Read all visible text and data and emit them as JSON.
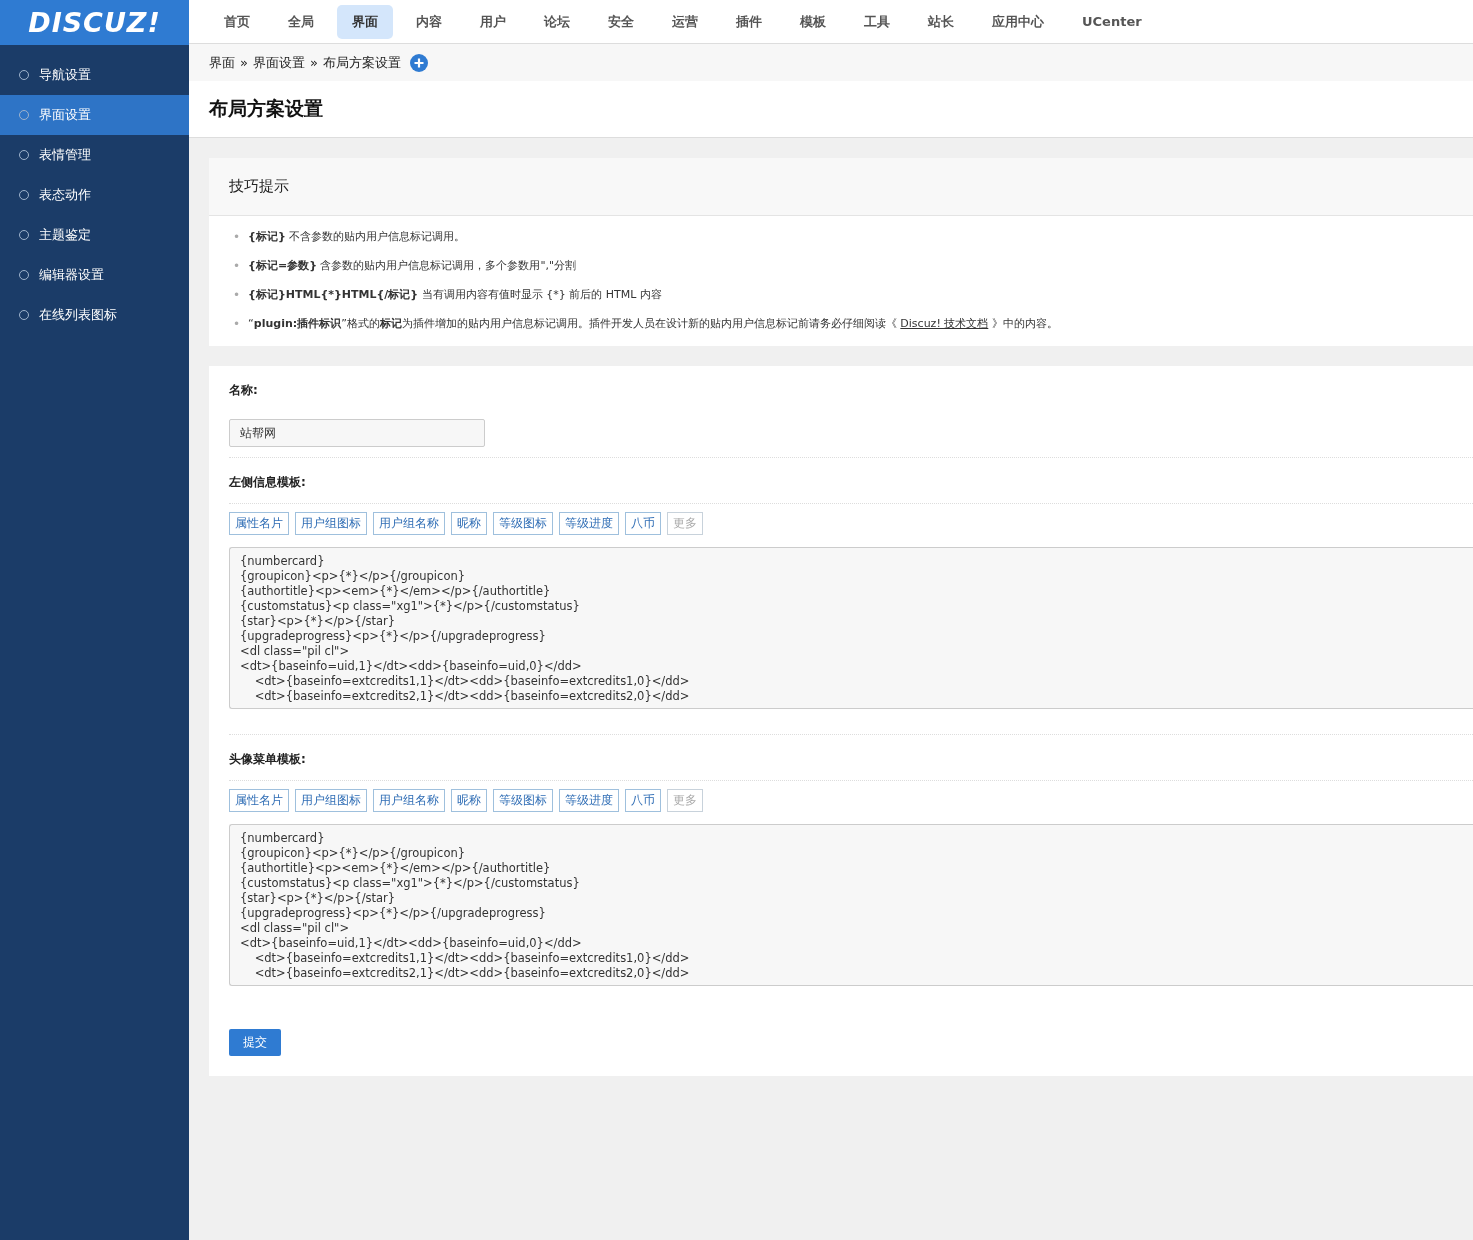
{
  "logo": "DISCUZ!",
  "top_nav": [
    {
      "label": "首页",
      "selected": false
    },
    {
      "label": "全局",
      "selected": false
    },
    {
      "label": "界面",
      "selected": true
    },
    {
      "label": "内容",
      "selected": false
    },
    {
      "label": "用户",
      "selected": false
    },
    {
      "label": "论坛",
      "selected": false
    },
    {
      "label": "安全",
      "selected": false
    },
    {
      "label": "运营",
      "selected": false
    },
    {
      "label": "插件",
      "selected": false
    },
    {
      "label": "模板",
      "selected": false
    },
    {
      "label": "工具",
      "selected": false
    },
    {
      "label": "站长",
      "selected": false
    },
    {
      "label": "应用中心",
      "selected": false
    },
    {
      "label": "UCenter",
      "selected": false
    }
  ],
  "sidebar": {
    "items": [
      {
        "label": "导航设置",
        "selected": false
      },
      {
        "label": "界面设置",
        "selected": true
      },
      {
        "label": "表情管理",
        "selected": false
      },
      {
        "label": "表态动作",
        "selected": false
      },
      {
        "label": "主题鉴定",
        "selected": false
      },
      {
        "label": "编辑器设置",
        "selected": false
      },
      {
        "label": "在线列表图标",
        "selected": false
      }
    ]
  },
  "breadcrumb": [
    "界面",
    "界面设置",
    "布局方案设置"
  ],
  "breadcrumb_separator": "»",
  "page_title": "布局方案设置",
  "tips": {
    "title": "技巧提示",
    "bullet": "•",
    "items": [
      {
        "parts": [
          {
            "kind": "bold",
            "text": "{标记}"
          },
          {
            "kind": "plain",
            "text": " 不含参数的贴内用户信息标记调用。"
          }
        ]
      },
      {
        "parts": [
          {
            "kind": "bold",
            "text": "{标记=参数}"
          },
          {
            "kind": "plain",
            "text": " 含参数的贴内用户信息标记调用，多个参数用\",\"分割"
          }
        ]
      },
      {
        "parts": [
          {
            "kind": "bold",
            "text": "{标记}HTML{*}HTML{/标记}"
          },
          {
            "kind": "plain",
            "text": " 当有调用内容有值时显示 {*} 前后的 HTML 内容"
          }
        ]
      },
      {
        "parts": [
          {
            "kind": "plain",
            "text": "“"
          },
          {
            "kind": "bold",
            "text": "plugin:插件标识"
          },
          {
            "kind": "plain",
            "text": "”格式的"
          },
          {
            "kind": "bold",
            "text": "标记"
          },
          {
            "kind": "plain",
            "text": "为插件增加的贴内用户信息标记调用。插件开发人员在设计新的贴内用户信息标记前请务必仔细阅读《 "
          },
          {
            "kind": "link",
            "text": "Discuz! 技术文档"
          },
          {
            "kind": "plain",
            "text": " 》中的内容。"
          }
        ]
      }
    ]
  },
  "form": {
    "name_label": "名称:",
    "name_value": "站帮网",
    "templates": [
      {
        "label": "左侧信息模板:",
        "buttons": [
          {
            "label": "属性名片",
            "disabled": false
          },
          {
            "label": "用户组图标",
            "disabled": false
          },
          {
            "label": "用户组名称",
            "disabled": false
          },
          {
            "label": "昵称",
            "disabled": false
          },
          {
            "label": "等级图标",
            "disabled": false
          },
          {
            "label": "等级进度",
            "disabled": false
          },
          {
            "label": "八币",
            "disabled": false
          },
          {
            "label": "更多",
            "disabled": true
          }
        ],
        "lines": [
          "{numbercard}",
          "{groupicon}<p>{*}</p>{/groupicon}",
          "{authortitle}<p><em>{*}</em></p>{/authortitle}",
          "{customstatus}<p class=\"xg1\">{*}</p>{/customstatus}",
          "{star}<p>{*}</p>{/star}",
          "{upgradeprogress}<p>{*}</p>{/upgradeprogress}",
          "<dl class=\"pil cl\">",
          "<dt>{baseinfo=uid,1}</dt><dd>{baseinfo=uid,0}</dd>",
          "\t<dt>{baseinfo=extcredits1,1}</dt><dd>{baseinfo=extcredits1,0}</dd>",
          "\t<dt>{baseinfo=extcredits2,1}</dt><dd>{baseinfo=extcredits2,0}</dd>"
        ]
      },
      {
        "label": "头像菜单模板:",
        "buttons": [
          {
            "label": "属性名片",
            "disabled": false
          },
          {
            "label": "用户组图标",
            "disabled": false
          },
          {
            "label": "用户组名称",
            "disabled": false
          },
          {
            "label": "昵称",
            "disabled": false
          },
          {
            "label": "等级图标",
            "disabled": false
          },
          {
            "label": "等级进度",
            "disabled": false
          },
          {
            "label": "八币",
            "disabled": false
          },
          {
            "label": "更多",
            "disabled": true
          }
        ],
        "lines": [
          "{numbercard}",
          "{groupicon}<p>{*}</p>{/groupicon}",
          "{authortitle}<p><em>{*}</em></p>{/authortitle}",
          "{customstatus}<p class=\"xg1\">{*}</p>{/customstatus}",
          "{star}<p>{*}</p>{/star}",
          "{upgradeprogress}<p>{*}</p>{/upgradeprogress}",
          "<dl class=\"pil cl\">",
          "<dt>{baseinfo=uid,1}</dt><dd>{baseinfo=uid,0}</dd>",
          "\t<dt>{baseinfo=extcredits1,1}</dt><dd>{baseinfo=extcredits1,0}</dd>",
          "\t<dt>{baseinfo=extcredits2,1}</dt><dd>{baseinfo=extcredits2,0}</dd>"
        ]
      }
    ],
    "submit": "提交"
  }
}
